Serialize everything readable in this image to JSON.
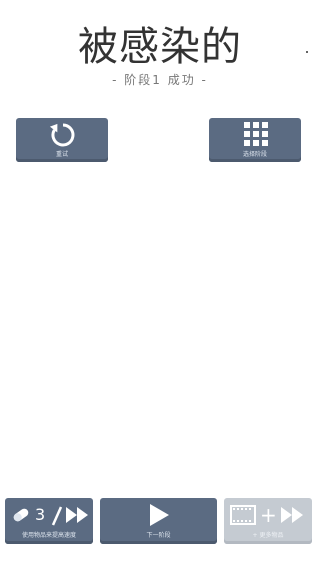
{
  "title": "被感染的",
  "subtitle": "- 阶段1 成功 -",
  "top_buttons": {
    "retry": {
      "label": "重试",
      "icon": "retry-icon"
    },
    "select_stage": {
      "label": "选择阶段",
      "icon": "grid-icon"
    }
  },
  "bottom_buttons": {
    "use_item": {
      "count": "3",
      "label": "使用物品来提高速度",
      "icons": [
        "pill-icon",
        "fast-forward-icon"
      ]
    },
    "next_stage": {
      "label": "下一阶段",
      "icon": "play-icon"
    },
    "more_items": {
      "label": "+ 更多物品",
      "icons": [
        "film-icon",
        "fast-forward-icon"
      ],
      "state": "disabled"
    }
  },
  "colors": {
    "button": "#5b6b82",
    "button_disabled": "#c5cbd2",
    "title": "#333333",
    "background": "#ffffff"
  }
}
